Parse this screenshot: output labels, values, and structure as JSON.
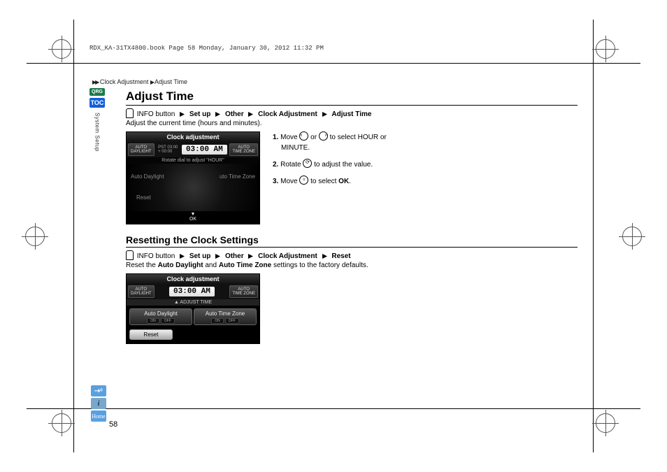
{
  "header": "RDX_KA-31TX4800.book  Page 58  Monday, January 30, 2012  11:32 PM",
  "breadcrumb": {
    "a": "Clock Adjustment",
    "b": "Adjust Time"
  },
  "sideTabs": {
    "qrg": "QRG",
    "toc": "TOC",
    "section": "System Setup"
  },
  "bottomIcons": {
    "voice": "⇢ᶜ",
    "info": "i",
    "home": "Home"
  },
  "pageNumber": "58",
  "section1": {
    "title": "Adjust Time",
    "nav": {
      "btn": "INFO button",
      "p1": "Set up",
      "p2": "Other",
      "p3": "Clock Adjustment",
      "p4": "Adjust Time"
    },
    "lead": "Adjust the current time (hours and minutes).",
    "screen": {
      "title": "Clock adjustment",
      "leftPill": "AUTO\nDAYLIGHT",
      "pst1": "PST 03:00",
      "pst2": "+ 00:00",
      "time": "03:00 AM",
      "rightPill": "AUTO\nTIME ZONE",
      "hint": "Rotate dial to adjust \"HOUR\"",
      "optDaylight": "Auto Daylight",
      "optZone": "uto Time Zone",
      "optReset": "Reset",
      "footer": "▼\nOK"
    },
    "steps": {
      "s1a": "Move ",
      "s1mid": " or ",
      "s1b": " to select HOUR or",
      "s1c": "MINUTE.",
      "s2a": "Rotate ",
      "s2b": " to adjust the value.",
      "s3a": "Move ",
      "s3b": " to select ",
      "s3ok": "OK",
      "s3c": "."
    }
  },
  "section2": {
    "title": "Resetting the Clock Settings",
    "nav": {
      "btn": "INFO button",
      "p1": "Set up",
      "p2": "Other",
      "p3": "Clock Adjustment",
      "p4": "Reset"
    },
    "leadA": "Reset the ",
    "leadB": "Auto Daylight",
    "leadC": " and ",
    "leadD": "Auto Time Zone",
    "leadE": " settings to the factory defaults.",
    "screen": {
      "title": "Clock adjustment",
      "leftPill": "AUTO\nDAYLIGHT",
      "time": "03:00 AM",
      "rightPill": "AUTO\nTIME ZONE",
      "adjline": "▲ ADJUST TIME",
      "btnDaylight": "Auto Daylight",
      "btnZone": "Auto Time Zone",
      "on": "ON",
      "off": "OFF",
      "reset": "Reset"
    }
  }
}
